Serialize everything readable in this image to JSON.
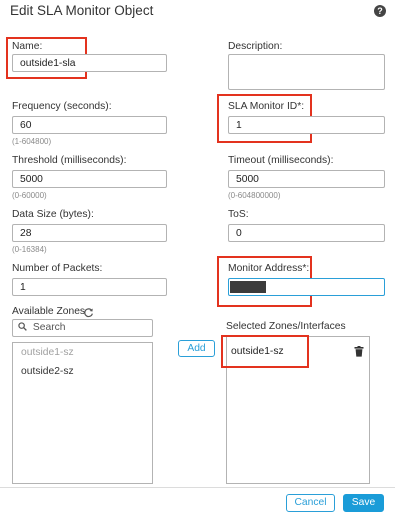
{
  "dialog": {
    "title": "Edit SLA Monitor Object"
  },
  "form": {
    "name": {
      "label": "Name:",
      "value": "outside1-sla"
    },
    "description": {
      "label": "Description:",
      "value": ""
    },
    "frequency": {
      "label": "Frequency (seconds):",
      "value": "60",
      "hint": "(1-604800)"
    },
    "sla_monitor_id": {
      "label": "SLA Monitor ID*:",
      "value": "1"
    },
    "threshold": {
      "label": "Threshold (milliseconds):",
      "value": "5000",
      "hint": "(0-60000)"
    },
    "timeout": {
      "label": "Timeout (milliseconds):",
      "value": "5000",
      "hint": "(0-604800000)"
    },
    "data_size": {
      "label": "Data Size (bytes):",
      "value": "28",
      "hint": "(0-16384)"
    },
    "tos": {
      "label": "ToS:",
      "value": "0"
    },
    "num_packets": {
      "label": "Number of Packets:",
      "value": "1"
    },
    "monitor_address": {
      "label": "Monitor Address*:",
      "value": ""
    }
  },
  "zones": {
    "available_label": "Available Zones",
    "search_placeholder": "Search",
    "available_items": [
      {
        "label": "outside1-sz",
        "disabled": true
      },
      {
        "label": "outside2-sz",
        "disabled": false
      }
    ],
    "add_label": "Add",
    "selected_label": "Selected Zones/Interfaces",
    "selected_items": [
      {
        "label": "outside1-sz"
      }
    ]
  },
  "footer": {
    "cancel_label": "Cancel",
    "save_label": "Save"
  },
  "icons": {
    "help": "help-icon",
    "refresh": "refresh-icon",
    "search": "search-icon",
    "trash": "trash-icon"
  },
  "colors": {
    "accent": "#1a9cd8",
    "highlight_box": "#e3321e",
    "disabled_text": "#a0a0a0"
  }
}
